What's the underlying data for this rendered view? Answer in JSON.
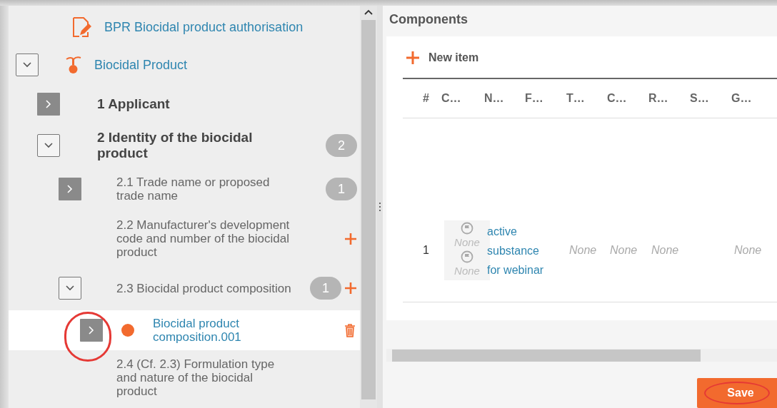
{
  "tree": [
    {
      "kind": "document",
      "label": "BPR Biocidal product authorisation",
      "selected": false
    },
    {
      "kind": "product",
      "label": "Biocidal Product",
      "expanded": true,
      "selected": false,
      "children": [
        {
          "kind": "section",
          "label": "1 Applicant",
          "expanded": false,
          "selected": false
        },
        {
          "kind": "section",
          "label": "2 Identity of the biocidal product",
          "expanded": true,
          "badge": "2",
          "selected": false,
          "children": [
            {
              "kind": "subsection",
              "label": "2.1 Trade name or proposed trade name",
              "expanded": false,
              "badge": "1",
              "selected": false
            },
            {
              "kind": "subsection",
              "label": "2.2 Manufacturer's development code and number of the biocidal product",
              "can_add": true,
              "selected": false
            },
            {
              "kind": "subsection",
              "label": "2.3 Biocidal product composition",
              "expanded": true,
              "badge": "1",
              "can_add": true,
              "selected": false,
              "children": [
                {
                  "kind": "record",
                  "label": "Biocidal product composition.001",
                  "expanded": false,
                  "can_delete": true,
                  "selected": true
                }
              ]
            },
            {
              "kind": "subsection",
              "label": "2.4 (Cf. 2.3) Formulation type and nature of the biocidal product",
              "selected": false
            }
          ]
        }
      ]
    }
  ],
  "components": {
    "title": "Components",
    "new_item": "New item",
    "columns": [
      "#",
      "C…",
      "N…",
      "F…",
      "T…",
      "C…",
      "R…",
      "S…",
      "G…"
    ],
    "rows": [
      {
        "cells": [
          {
            "kind": "number",
            "text": "1"
          },
          {
            "kind": "flags",
            "values": [
              "None",
              "None"
            ]
          },
          {
            "kind": "link",
            "text": "active substance for webinar"
          },
          "",
          "None",
          "None",
          "None",
          "",
          "None"
        ]
      }
    ]
  },
  "save_button": "Save"
}
